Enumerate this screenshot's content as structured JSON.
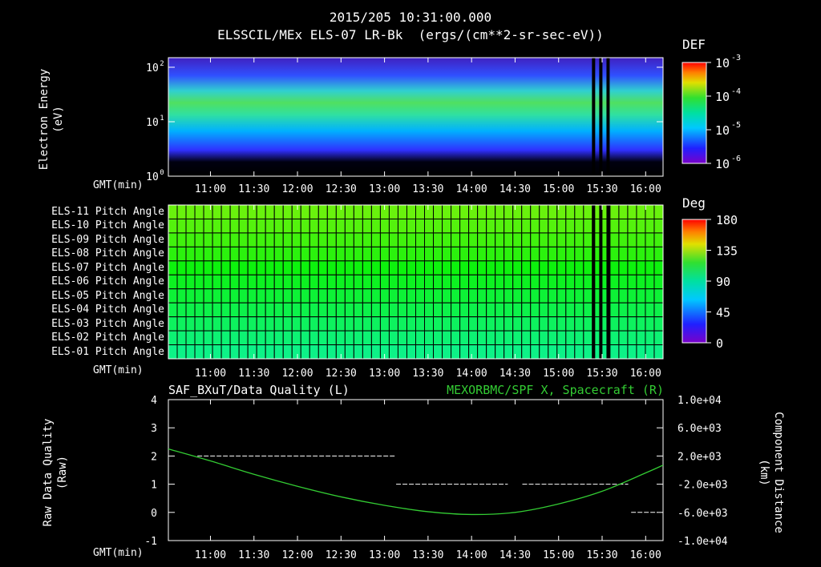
{
  "header": {
    "timestamp": "2015/205 10:31:00.000",
    "title": "ELSSCIL/MEx ELS-07 LR-Bk  (ergs/(cm**2-sr-sec-eV))"
  },
  "time_axis": {
    "label": "GMT(min)",
    "ticks": [
      "11:00",
      "11:30",
      "12:00",
      "12:30",
      "13:00",
      "13:30",
      "14:00",
      "14:30",
      "15:00",
      "15:30",
      "16:00"
    ]
  },
  "colors": {
    "black": "#000000",
    "white": "#ffffff",
    "green_line": "#33cc33",
    "grid": "#000000"
  },
  "chart_data": [
    {
      "type": "heatmap",
      "name": "spectrogram",
      "ylabel": "Electron Energy\n(eV)",
      "yscale": "log",
      "ylim": [
        1,
        150
      ],
      "yticks": [
        {
          "base": "10",
          "exp": "0"
        },
        {
          "base": "10",
          "exp": "1"
        },
        {
          "base": "10",
          "exp": "2"
        }
      ],
      "colorbar": {
        "label": "DEF",
        "scale": "log",
        "ticks": [
          {
            "base": "10",
            "exp": "-3"
          },
          {
            "base": "10",
            "exp": "-4"
          },
          {
            "base": "10",
            "exp": "-5"
          },
          {
            "base": "10",
            "exp": "-6"
          }
        ]
      },
      "data_gaps": [
        "15:23",
        "15:28",
        "15:33"
      ]
    },
    {
      "type": "heatmap",
      "name": "pitch_angle",
      "rows": [
        "ELS-11 Pitch Angle",
        "ELS-10 Pitch Angle",
        "ELS-09 Pitch Angle",
        "ELS-08 Pitch Angle",
        "ELS-07 Pitch Angle",
        "ELS-06 Pitch Angle",
        "ELS-05 Pitch Angle",
        "ELS-04 Pitch Angle",
        "ELS-03 Pitch Angle",
        "ELS-02 Pitch Angle",
        "ELS-01 Pitch Angle"
      ],
      "colorbar": {
        "label": "Deg",
        "ticks": [
          "180",
          "135",
          "90",
          "45",
          "0"
        ],
        "range": [
          0,
          180
        ]
      },
      "row_values": [
        108,
        104,
        100,
        96,
        90,
        86,
        82,
        78,
        74,
        70,
        66
      ]
    },
    {
      "type": "line",
      "name": "quality_and_distance",
      "left_title": "SAF_BXuT/Data Quality (L)",
      "right_title": "MEXORBMC/SPF X, Spacecraft (R)",
      "ylabel_left": "Raw Data Quality\n(Raw)",
      "ylabel_right": "Component Distance\n(km)",
      "ylim_left": [
        -1,
        4
      ],
      "yticks_left": [
        "4",
        "3",
        "2",
        "1",
        "0",
        "-1"
      ],
      "ylim_right": [
        -10000,
        10000
      ],
      "yticks_right": [
        "1.0e+04",
        "6.0e+03",
        "2.0e+03",
        "-2.0e+03",
        "-6.0e+03",
        "-1.0e+04"
      ],
      "quality_segments": [
        {
          "start": "10:51",
          "end": "13:08",
          "value": 2
        },
        {
          "start": "13:08",
          "end": "14:25",
          "value": 1
        },
        {
          "start": "14:35",
          "end": "15:48",
          "value": 1
        },
        {
          "start": "15:50",
          "end": "16:08",
          "value": 0
        }
      ],
      "distance_km": {
        "x": [
          "10:31",
          "11:00",
          "11:30",
          "12:00",
          "12:30",
          "13:00",
          "13:30",
          "14:00",
          "14:30",
          "15:00",
          "15:30",
          "16:00",
          "16:12"
        ],
        "y": [
          3000,
          1300,
          -600,
          -2300,
          -3800,
          -5000,
          -5900,
          -6300,
          -6000,
          -4800,
          -3000,
          -400,
          700
        ]
      }
    }
  ]
}
